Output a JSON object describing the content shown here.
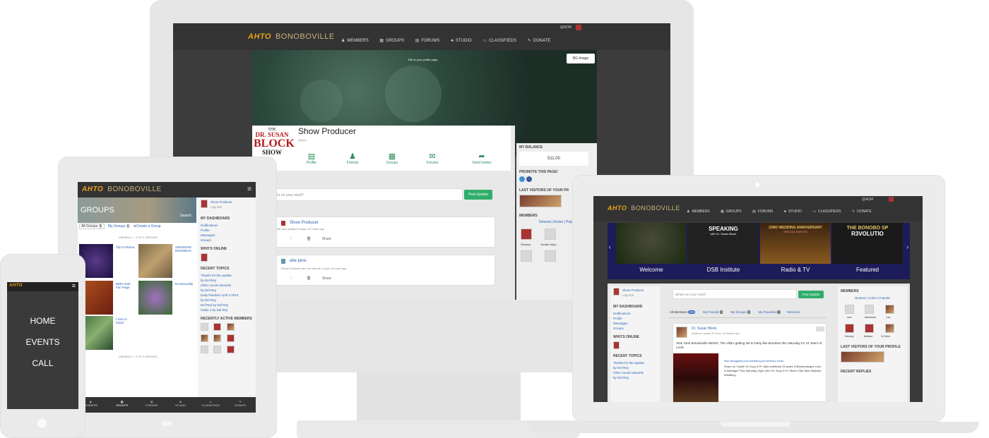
{
  "brand": "BONOBOVILLE",
  "logo_text": "AHTO",
  "nav": [
    "MEMBERS",
    "GROUPS",
    "FORUMS",
    "STUDIO",
    "CLASSIFIEDS",
    "DONATE"
  ],
  "topbar": {
    "user": "@ADM"
  },
  "desktop": {
    "cover_caption": "This is your profile page.",
    "bg_image_btn": "BG Image",
    "profile_name": "Show Producer",
    "handle": "@adm",
    "avatar_text": {
      "line1": "THE",
      "line2": "DR. SUSAN",
      "line3": "BLOCK",
      "line4": "SHOW"
    },
    "tabs": [
      "Profile",
      "Friends",
      "Groups",
      "Forums",
      "Send Invites"
    ],
    "balance_label": "MY BALANCE",
    "balance_value": "511.00",
    "promote_label": "PROMOTE THIS PAGE!",
    "last_visitors_label": "LAST VISITORS OF YOUR PR",
    "members_label": "MEMBERS",
    "members_filter": "Newest | Active | Popu",
    "member_names": [
      "Smokey",
      "Neville Mary"
    ],
    "mind_placeholder": "at's on your mind?",
    "post_update": "Post Update",
    "activity": [
      {
        "name": "Show Producer",
        "meta": "profile was updated 3 days, 22 hours ago",
        "action": "Share"
      },
      {
        "name": "abe pere",
        "meta": "Show Producer are now friends 4 days, 8 hours ago",
        "action": "Share"
      }
    ]
  },
  "tablet": {
    "groups_title": "GROUPS",
    "search": "Search",
    "all_groups": "All Groups",
    "all_groups_count": "5",
    "my_groups": "My Groups",
    "my_groups_count": "0",
    "create_group": "Create a Group",
    "viewing": "VIEWING 1 - 5 OF 5 GROUPS",
    "groups": [
      "Clip-O-Rama",
      "SWINGING BONOBOS",
      "Belle Starr Fan Page",
      "Ecosexuality",
      "I love to travel"
    ],
    "user": "Show Producer",
    "logout": "Log Out",
    "dashboard_label": "MY DASHBOARD",
    "dashboard_items": [
      "Notifications",
      "Profile",
      "Messages",
      "Groups"
    ],
    "whos_online": "WHO'S ONLINE",
    "recent_topics": "RECENT TOPICS",
    "topics": [
      "Thanks for the update.",
      "by Del Rey",
      "Other social networks",
      "by Del Rey",
      "Daily Random April 3 2015",
      "by Del Rey",
      "Del Rey by Del Rey",
      "Haiku 1 by Del Rey"
    ],
    "recently_active": "RECENTLY ACTIVE MEMBERS",
    "bottom_nav": [
      "MEMBERS",
      "GROUPS",
      "FORUMS",
      "STUDIO",
      "CLASSIFIEDS",
      "DONATE"
    ]
  },
  "phone": {
    "menu": [
      "HOME",
      "EVENTS",
      "CALL"
    ]
  },
  "laptop": {
    "slides": [
      {
        "label": "Welcome"
      },
      {
        "label": "DSB Institute",
        "headline": "SPEAKING",
        "sub": "with Dr. Susan Block"
      },
      {
        "label": "Radio & TV",
        "headline": "23RD WEDDING ANNIVERSARY",
        "sub": "SPECIAL EVENTS"
      },
      {
        "label": "Featured",
        "headline": "THE BONOBO SP",
        "sub": "R3VOLUTIO"
      }
    ],
    "prev": "‹",
    "next": "›",
    "user": "Show Producer",
    "logout": "Log Out",
    "dashboard_label": "MY DASHBOARD",
    "dashboard_items": [
      "Notifications",
      "Profile",
      "Messages",
      "Groups"
    ],
    "whos_online": "WHO'S ONLINE",
    "recent_topics": "RECENT TOPICS",
    "topics": [
      "Thanks for the update.",
      "by Del Rey",
      "Other social networks",
      "by Del Rey"
    ],
    "mind_placeholder": "What's on your mind?",
    "post_update": "Post Update",
    "filters": [
      {
        "label": "All Members",
        "count": "203"
      },
      {
        "label": "My Friends",
        "count": "0"
      },
      {
        "label": "My Groups",
        "count": "0"
      },
      {
        "label": "My Favorites",
        "count": "0"
      },
      {
        "label": "Mentions",
        "count": ""
      }
    ],
    "post_author": "Dr. Susan Block",
    "post_meta": "posted an update 23 hours, 15 minutes ago",
    "post_text": "Xtra! Xtra! Bonoboville NEWS: The Villa's getting set to Party like Bonobos this Saturday for 23 Years of LoVE",
    "post_link": "http://bloggamy.com/wedding-anniversary-news",
    "post_link_text": "Share on Tumblr Dr Suzy & Pr. Max celebrate 23 years of Bonobobsque Love & Marriage! This Saturday, April 11th: Dr. Suzy & Pr. Max's 23rd Star-Studded Wedding…",
    "members_label": "MEMBERS",
    "members_filter": "Newest | Active | Popular",
    "member_names": [
      "sam",
      "darthnasia",
      "Luis",
      "Smokey",
      "Bellstarr",
      "Dr Mers"
    ],
    "last_visitors": "LAST VISITORS OF YOUR PROFILE",
    "recent_replies": "RECENT REPLIES"
  }
}
